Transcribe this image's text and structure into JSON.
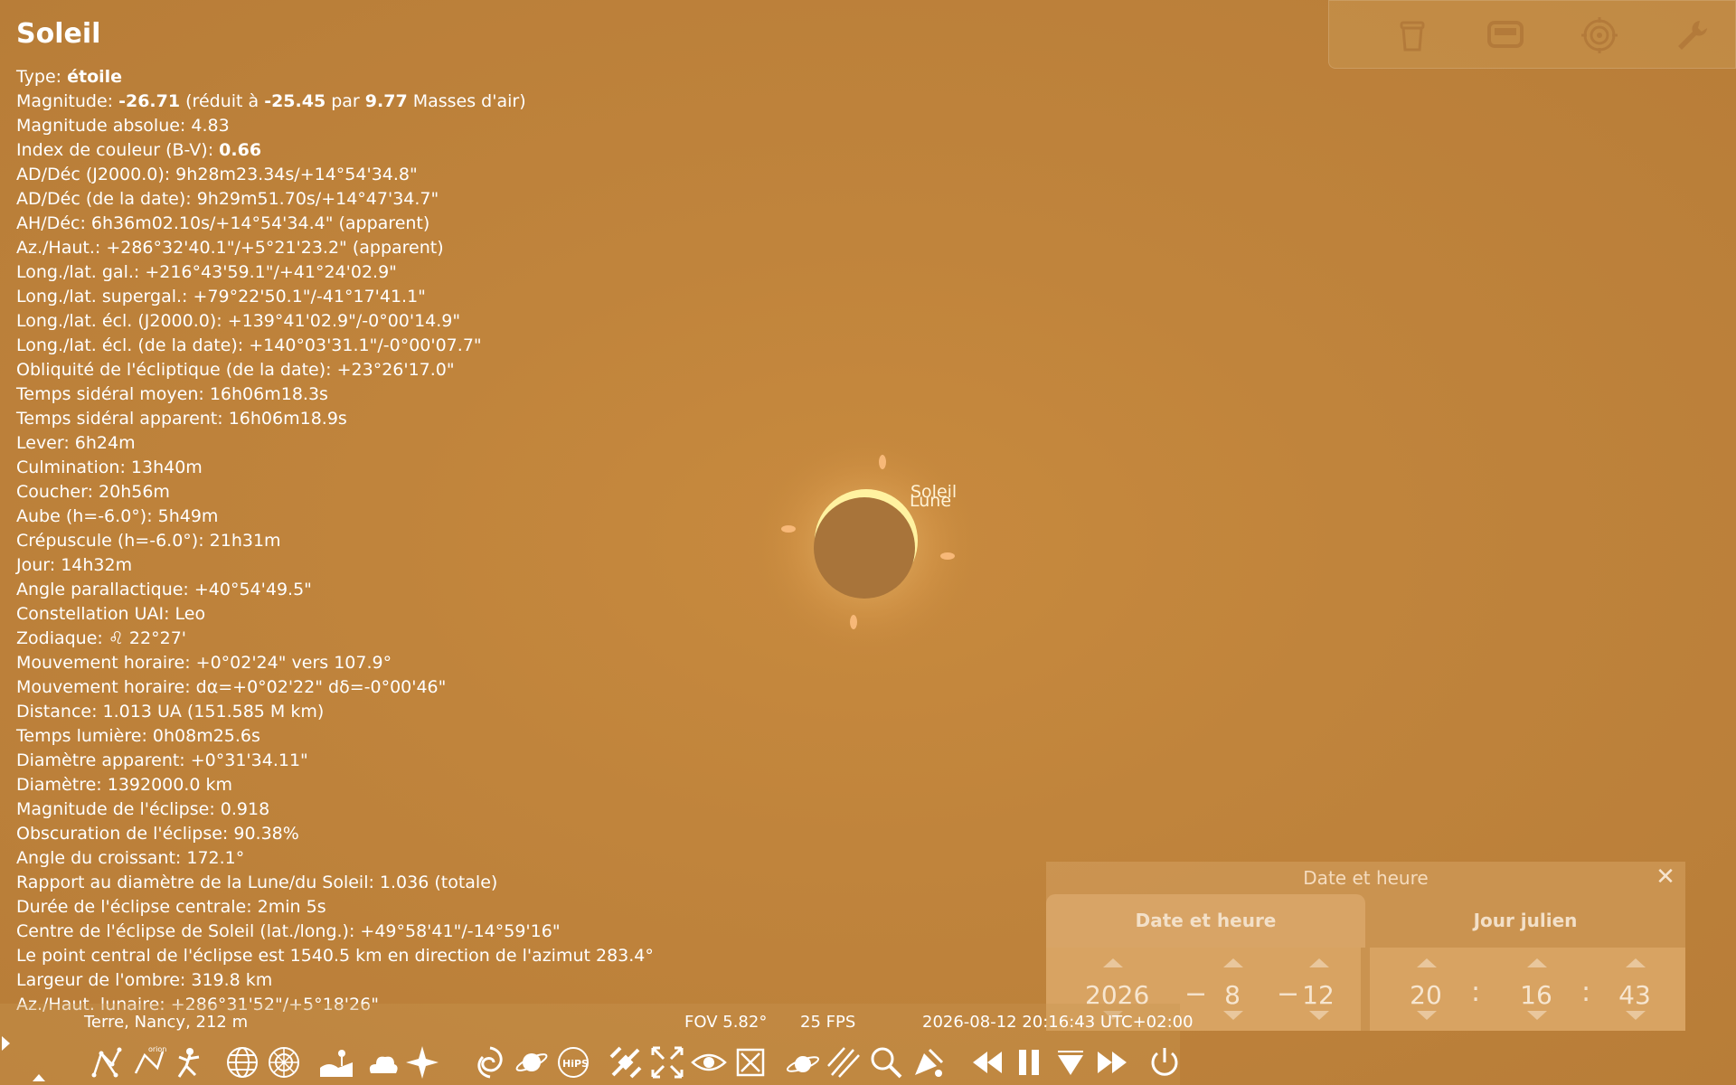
{
  "info": {
    "title": "Soleil",
    "type_label": "Type: ",
    "type_value": "étoile",
    "mag_label": "Magnitude: ",
    "mag_value": "-26.71",
    "mag_mid1": " (réduit à ",
    "mag_reduced": "-25.45",
    "mag_mid2": " par ",
    "mag_airmass": "9.77",
    "mag_end": " Masses d'air)",
    "absmag": "Magnitude absolue: 4.83",
    "bv_label": "Index de couleur (B-V): ",
    "bv_value": "0.66",
    "lines": [
      "AD/Déc (J2000.0): 9h28m23.34s/+14°54'34.8\"",
      "AD/Déc (de la date): 9h29m51.70s/+14°47'34.7\"",
      "AH/Déc: 6h36m02.10s/+14°54'34.4\" (apparent)",
      "Az./Haut.: +286°32'40.1\"/+5°21'23.2\" (apparent)",
      "Long./lat. gal.: +216°43'59.1\"/+41°24'02.9\"",
      "Long./lat. supergal.: +79°22'50.1\"/-41°17'41.1\"",
      "Long./lat. écl. (J2000.0): +139°41'02.9\"/-0°00'14.9\"",
      "Long./lat. écl. (de la date): +140°03'31.1\"/-0°00'07.7\"",
      "Obliquité de l'écliptique (de la date): +23°26'17.0\"",
      "Temps sidéral moyen: 16h06m18.3s",
      "Temps sidéral apparent: 16h06m18.9s",
      "Lever: 6h24m",
      "Culmination: 13h40m",
      "Coucher: 20h56m",
      "Aube (h=-6.0°): 5h49m",
      "Crépuscule (h=-6.0°): 21h31m",
      "Jour: 14h32m",
      "Angle parallactique: +40°54'49.5\"",
      "Constellation UAI: Leo",
      "Zodiaque: ♌ 22°27'",
      "Mouvement horaire: +0°02'24\" vers 107.9°",
      "Mouvement horaire: dα=+0°02'22\" dδ=-0°00'46\"",
      "Distance: 1.013 UA (151.585 M km)",
      "Temps lumière: 0h08m25.6s",
      "Diamètre apparent: +0°31'34.11\"",
      "Diamètre: 1392000.0 km",
      "Magnitude de l'éclipse: 0.918",
      "Obscuration de l'éclipse: 90.38%",
      "Angle du croissant: 172.1°",
      "Rapport au diamètre de la Lune/du Soleil: 1.036 (totale)",
      "Durée de l'éclipse centrale: 2min 5s",
      "Centre de l'éclipse de Soleil (lat./long.): +49°58'41\"/-14°59'16\"",
      "Le point central de l'éclipse est 1540.5 km en direction de l'azimut 283.4°",
      "Largeur de l'ombre: 319.8 km",
      "Az./Haut. lunaire: +286°31'52\"/+5°18'26\""
    ]
  },
  "sky": {
    "label_sun": "Soleil",
    "label_moon": "Lune"
  },
  "date_panel": {
    "title": "Date et heure",
    "tab_date": "Date et heure",
    "tab_jd": "Jour julien",
    "year": "2026",
    "month": "8",
    "day": "12",
    "hour": "20",
    "minute": "16",
    "second": "43",
    "date_sep": "−",
    "time_sep": ":"
  },
  "status": {
    "location": "Terre, Nancy, 212 m",
    "fov": "FOV 5.82°",
    "fps": "25 FPS",
    "datetime": "2026-08-12 20:16:43 UTC+02:00"
  },
  "colors": {
    "sky": "#c0843c",
    "crescent": "#fff2a0",
    "moon_disk": "#a8743a"
  }
}
